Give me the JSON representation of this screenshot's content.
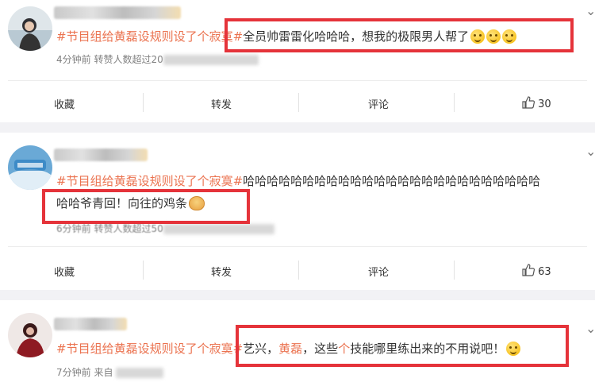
{
  "posts": [
    {
      "topic": "#节目组给黄磊设规则设了个寂寞#",
      "text_parts": [
        "全员帅雷雷化哈哈哈，想我的极限男人帮了"
      ],
      "meta": "4分钟前 转赞人数超过20",
      "actions": {
        "collect": "收藏",
        "repost": "转发",
        "comment": "评论",
        "like_count": "30"
      }
    },
    {
      "topic": "#节目组给黄磊设规则设了个寂寞#",
      "line1": "哈哈哈哈哈哈哈哈哈哈哈哈哈哈哈哈哈哈哈哈哈哈哈哈哈",
      "line2": "哈哈爷青回！向往的鸡条",
      "meta": "6分钟前 转赞人数超过50",
      "actions": {
        "collect": "收藏",
        "repost": "转发",
        "comment": "评论",
        "like_count": "63"
      }
    },
    {
      "topic": "#节目组给黄磊设规则设了个寂寞#",
      "text_a": "艺兴，",
      "text_b": "黄磊",
      "text_c": "，这些",
      "text_d": "个",
      "text_e": "技能哪里练出来的不用说吧！",
      "meta": "7分钟前 来自"
    }
  ],
  "colors": {
    "topic": "#eb7350",
    "highlight_box": "#e5333a",
    "background": "#f2f2f5"
  },
  "icons": [
    "chevron-down-icon",
    "thumbs-up-icon",
    "crying-emoji-icon",
    "chick-emoji-icon",
    "grin-emoji-icon"
  ]
}
